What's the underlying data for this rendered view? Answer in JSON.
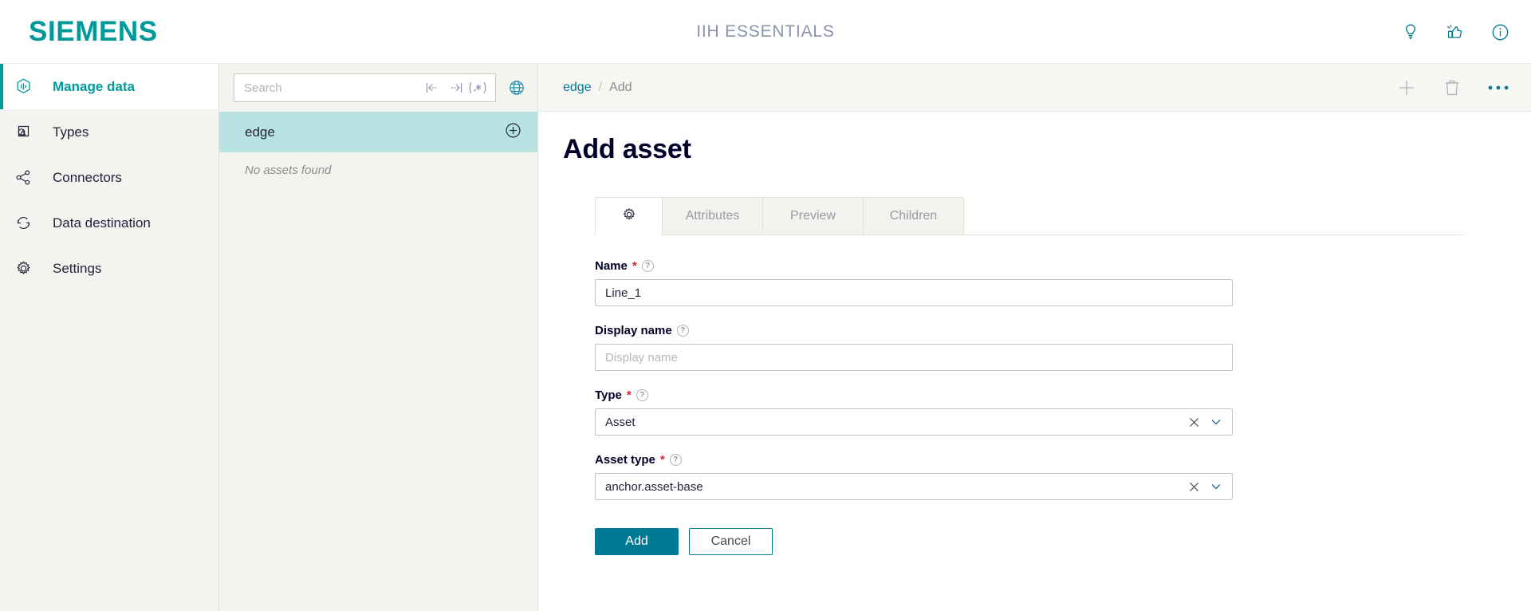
{
  "header": {
    "brand": "SIEMENS",
    "app_title": "IIH ESSENTIALS",
    "icons": [
      {
        "name": "lightbulb-icon",
        "label": "Tips"
      },
      {
        "name": "feedback-icon",
        "label": "Feedback"
      },
      {
        "name": "info-icon",
        "label": "Information"
      }
    ],
    "accent_color": "#009999"
  },
  "sidebar": {
    "items": [
      {
        "label": "Manage data",
        "icon": "manage-data-icon",
        "active": true
      },
      {
        "label": "Types",
        "icon": "types-icon",
        "active": false
      },
      {
        "label": "Connectors",
        "icon": "connectors-icon",
        "active": false
      },
      {
        "label": "Data destination",
        "icon": "data-destination-icon",
        "active": false
      },
      {
        "label": "Settings",
        "icon": "settings-gear-icon",
        "active": false
      }
    ]
  },
  "asset_panel": {
    "search": {
      "placeholder": "Search",
      "value": "",
      "icons": [
        "match-start-icon",
        "match-end-icon",
        "regex-icon"
      ]
    },
    "globe_icon": "globe-icon",
    "root": {
      "label": "edge",
      "selected": true,
      "add_icon": "plus-circle-icon"
    },
    "empty_message": "No assets found"
  },
  "toolbar": {
    "breadcrumb": {
      "root": "edge",
      "separator": "/",
      "current": "Add"
    },
    "actions": [
      {
        "name": "add-icon",
        "label": "Add",
        "enabled": false
      },
      {
        "name": "delete-icon",
        "label": "Delete",
        "enabled": false
      },
      {
        "name": "more-options-icon",
        "label": "More",
        "enabled": true
      }
    ]
  },
  "main": {
    "page_title": "Add asset",
    "tabs": [
      {
        "label": "",
        "icon": "gear-icon",
        "active": true
      },
      {
        "label": "Attributes",
        "active": false
      },
      {
        "label": "Preview",
        "active": false
      },
      {
        "label": "Children",
        "active": false
      }
    ],
    "form": {
      "fields": [
        {
          "key": "name",
          "label": "Name",
          "required": true,
          "help": "?",
          "type": "text",
          "value": "Line_1",
          "placeholder": ""
        },
        {
          "key": "display_name",
          "label": "Display name",
          "required": false,
          "help": "?",
          "type": "text",
          "value": "",
          "placeholder": "Display name"
        },
        {
          "key": "type",
          "label": "Type",
          "required": true,
          "help": "?",
          "type": "select",
          "value": "Asset",
          "placeholder": ""
        },
        {
          "key": "asset_type",
          "label": "Asset type",
          "required": true,
          "help": "?",
          "type": "select",
          "value": "anchor.asset-base",
          "placeholder": ""
        }
      ],
      "required_marker": "*",
      "buttons": {
        "submit": "Add",
        "cancel": "Cancel"
      }
    }
  }
}
